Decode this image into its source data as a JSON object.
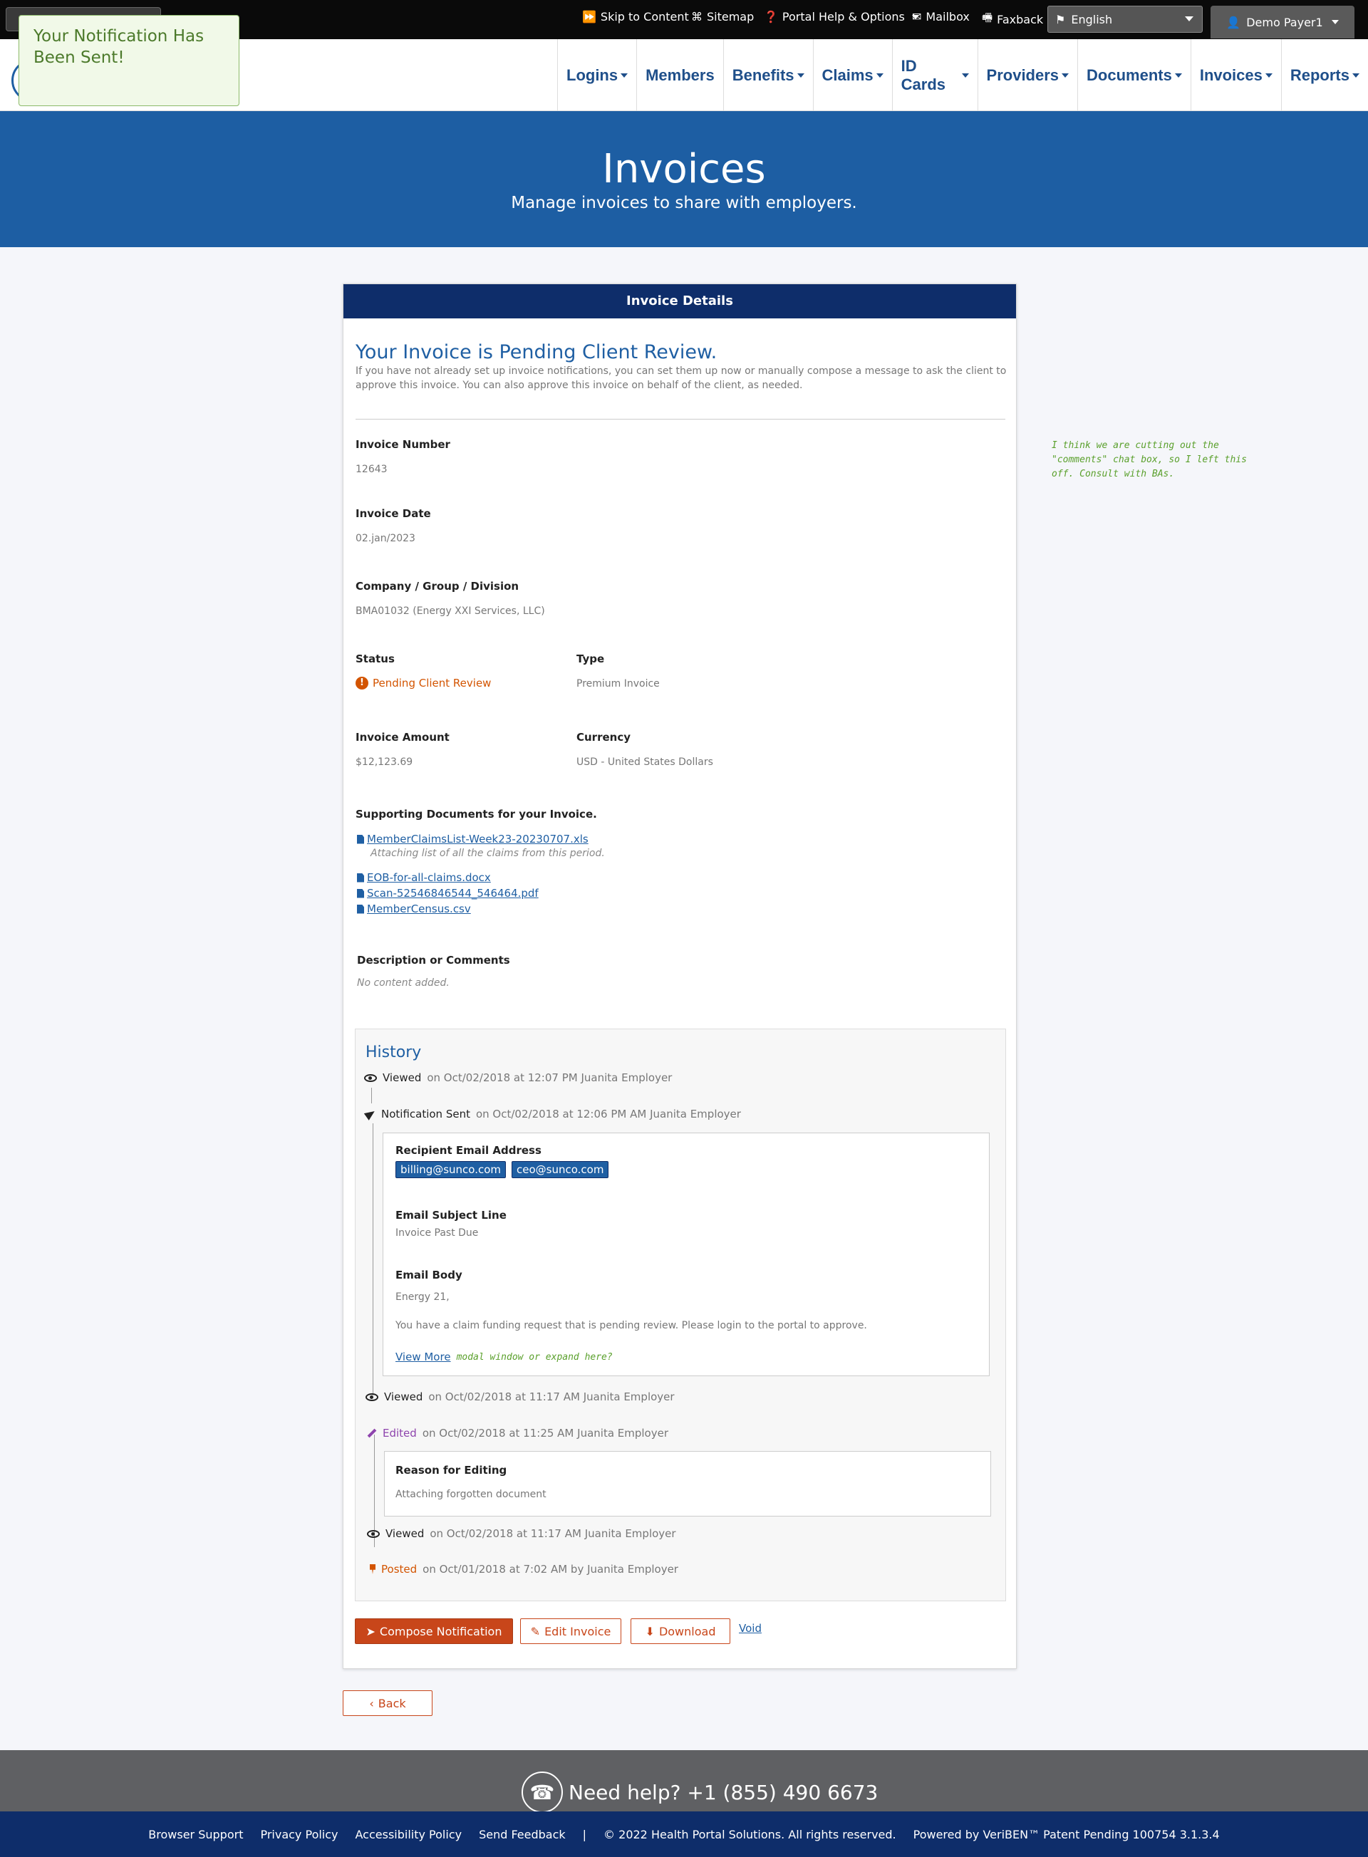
{
  "topbar": {
    "skip": "Skip to Content",
    "sitemap": "Sitemap",
    "help": "Portal Help & Options",
    "mailbox": "Mailbox",
    "faxback": "Faxback",
    "language": "English",
    "user": "Demo Payer1"
  },
  "toast": {
    "message": "Your Notification Has Been Sent!"
  },
  "nav": [
    "Logins",
    "Members",
    "Benefits",
    "Claims",
    "ID Cards",
    "Providers",
    "Documents",
    "Invoices",
    "Reports"
  ],
  "nav_has_caret": [
    true,
    false,
    true,
    true,
    true,
    true,
    true,
    true,
    true
  ],
  "hero": {
    "title": "Invoices",
    "subtitle": "Manage invoices to share with employers."
  },
  "card": {
    "header": "Invoice Details",
    "pending_title": "Your Invoice is Pending Client Review.",
    "pending_desc": "If you have not already set up invoice notifications, you can set them up now or manually compose a message to ask the client to approve this invoice. You can also approve this invoice on behalf of the client, as needed.",
    "invoice_number_label": "Invoice Number",
    "invoice_number": "12643",
    "invoice_date_label": "Invoice Date",
    "invoice_date": "02.jan/2023",
    "company_label": "Company / Group / Division",
    "company": "BMA01032 (Energy XXI Services, LLC)",
    "status_label": "Status",
    "status": "Pending Client Review",
    "type_label": "Type",
    "type": "Premium Invoice",
    "amount_label": "Invoice Amount",
    "amount": "$12,123.69",
    "currency_label": "Currency",
    "currency": "USD - United States Dollars",
    "docs_label": "Supporting Documents for your Invoice.",
    "docs": [
      {
        "name": "MemberClaimsList-Week23-20230707.xls",
        "note": "Attaching list of all the claims from this period."
      },
      {
        "name": "EOB-for-all-claims.docx"
      },
      {
        "name": "Scan-52546846544_546464.pdf"
      },
      {
        "name": "MemberCensus.csv"
      }
    ],
    "desc_label": "Description or Comments",
    "desc_value": "No content added."
  },
  "history": {
    "title": "History",
    "entries": [
      {
        "action": "Viewed",
        "meta": "on Oct/02/2018 at 12:07 PM Juanita Employer"
      },
      {
        "action": "Notification Sent",
        "meta": "on Oct/02/2018 at 12:06 PM AM Juanita Employer"
      },
      {
        "action": "Viewed",
        "meta": "on Oct/02/2018 at 11:17 AM Juanita Employer"
      },
      {
        "action": "Edited",
        "meta": "on Oct/02/2018 at 11:25 AM Juanita Employer"
      },
      {
        "action": "Viewed",
        "meta": "on Oct/02/2018 at 11:17 AM Juanita Employer"
      },
      {
        "action": "Posted",
        "meta": "on Oct/01/2018 at 7:02 AM by Juanita Employer"
      }
    ],
    "notification": {
      "recipient_label": "Recipient Email Address",
      "recipients": [
        "billing@sunco.com",
        "ceo@sunco.com"
      ],
      "subject_label": "Email Subject Line",
      "subject": "Invoice Past Due",
      "body_label": "Email Body",
      "body_greeting": "Energy 21,",
      "body_text": "You have a claim funding request that is pending review. Please login to the portal to approve.",
      "view_more": "View More",
      "view_more_note": "modal window or expand here?"
    },
    "edit": {
      "reason_label": "Reason for Editing",
      "reason": "Attaching forgotten document"
    }
  },
  "actions": {
    "compose": "Compose Notification",
    "edit": "Edit Invoice",
    "download": "Download",
    "void": "Void",
    "back": "Back"
  },
  "side_note": "I think we are cutting out the \"comments\" chat box, so I left this off. Consult with BAs.",
  "footer": {
    "help": "Need help? +1 (855) 490 6673",
    "links": [
      "Browser Support",
      "Privacy Policy",
      "Accessibility Policy",
      "Send Feedback",
      "|",
      "© 2022 Health Portal Solutions. All rights reserved.",
      "Powered by VeriBEN™ Patent Pending 100754 3.1.3.4"
    ]
  },
  "colors": {
    "navy": "#0e2d6a",
    "blue": "#1d5ea3",
    "orange": "#c8461a",
    "purple": "#8e44ad",
    "green": "#5aa02c"
  }
}
